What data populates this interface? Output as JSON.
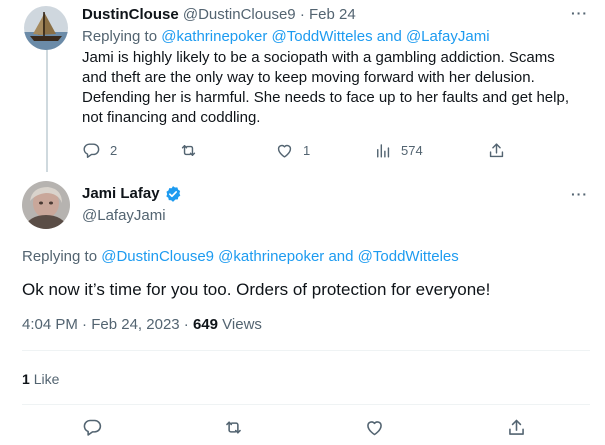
{
  "parent_tweet": {
    "display_name": "DustinClouse",
    "handle": "@DustinClouse9",
    "date": "Feb 24",
    "replying_prefix": "Replying to",
    "replying_mentions": "@kathrinepoker @ToddWitteles and @LafayJami",
    "body_lines": [
      "Jami is highly likely to be a sociopath with a gambling addiction.  Scams",
      "and theft are the only way to keep moving forward with her delusion.",
      "Defending her is harmful.  She needs to face up to her faults and get help,",
      "not financing and coddling."
    ],
    "reply_count": "2",
    "retweet_count": "",
    "like_count": "1",
    "view_count": "574",
    "more_label": "···"
  },
  "main_tweet": {
    "display_name": "Jami Lafay",
    "handle": "@LafayJami",
    "verified": true,
    "replying_prefix": "Replying to",
    "replying_mention_1": "@DustinClouse9",
    "replying_mention_2": "@kathrinepoker",
    "replying_and": "and",
    "replying_mention_3": "@ToddWitteles",
    "body": "Ok now it’s time for you too. Orders of protection for everyone!",
    "time": "4:04 PM",
    "separator": "·",
    "date": "Feb 24, 2023",
    "separator2": "·",
    "views": "649",
    "views_label": "Views",
    "likes_count": "1",
    "likes_label": "Like",
    "more_label": "···"
  },
  "colors": {
    "accent": "#1d9bf0",
    "muted_text": "#536471",
    "primary_text": "#0f1419",
    "divider": "#eff3f4"
  },
  "icons": {
    "reply": "reply-icon",
    "retweet": "retweet-icon",
    "like": "heart-icon",
    "views": "views-icon",
    "share": "share-icon",
    "verified": "verified-badge-icon"
  }
}
